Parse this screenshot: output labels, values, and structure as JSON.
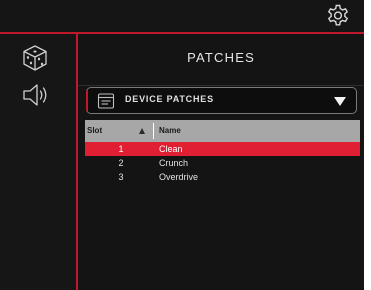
{
  "header": {
    "settings_icon": "gear-icon"
  },
  "sidebar": {
    "items": [
      {
        "icon": "dice-icon",
        "name": "presets"
      },
      {
        "icon": "speaker-icon",
        "name": "audio"
      }
    ]
  },
  "main": {
    "title": "PATCHES",
    "dropdown": {
      "icon": "device-icon",
      "selected": "DEVICE PATCHES"
    },
    "table": {
      "columns": [
        "Slot",
        "Name"
      ],
      "sort_column": "Slot",
      "sort_direction": "ascending",
      "rows": [
        {
          "slot": "1",
          "name": "Clean",
          "selected": true
        },
        {
          "slot": "2",
          "name": "Crunch",
          "selected": false
        },
        {
          "slot": "3",
          "name": "Overdrive",
          "selected": false
        }
      ]
    }
  },
  "colors": {
    "accent": "#c0182b",
    "selected_row": "#e01f33",
    "header_bg": "#a7a7a7",
    "background": "#111111"
  }
}
